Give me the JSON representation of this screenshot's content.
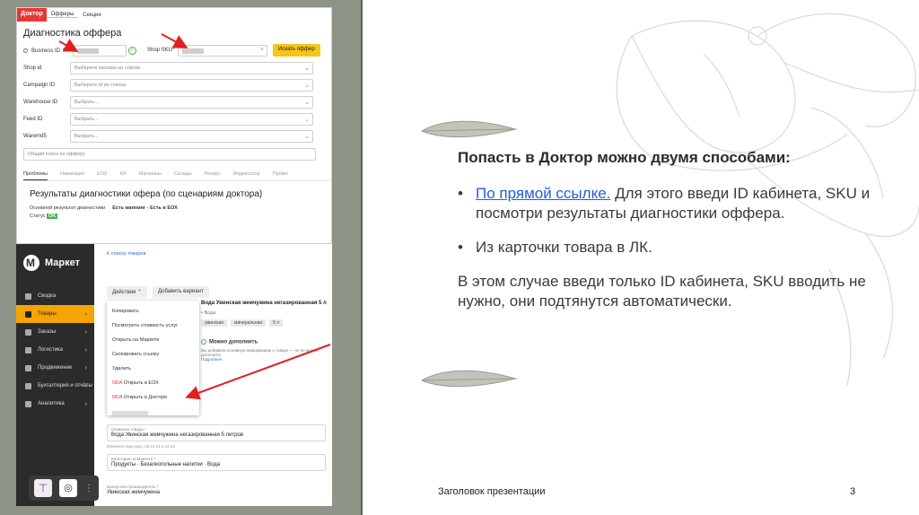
{
  "doctor": {
    "logo": "Доктор",
    "tabs": [
      "Офферы",
      "Секции"
    ],
    "title": "Диагностика оффера",
    "business_id_label": "Business ID ⇕",
    "shop_sku_label": "Shop SKU*",
    "search_button": "Искать оффер",
    "form": [
      {
        "label": "Shop id",
        "placeholder": "Выберите магазин из списка"
      },
      {
        "label": "Campaign ID",
        "placeholder": "Выберите id из списка"
      },
      {
        "label": "Warehouse ID",
        "placeholder": "Выбрать..."
      },
      {
        "label": "Feed ID",
        "placeholder": "Выбрать..."
      },
      {
        "label": "Waremd5",
        "placeholder": "Выбрать..."
      }
    ],
    "general_search_placeholder": "Общий поиск по офферу",
    "result_tabs": [
      "Проблемы",
      "Навигация",
      "ЕОХ",
      "КИ",
      "Магазины",
      "Склады",
      "Репорт",
      "Индексатор",
      "Промо"
    ],
    "results_title": "Результаты диагностики офера (по сценариям доктора)",
    "main_result_label": "Основной результат диагностики",
    "main_result_value": "Есть маппинг - Есть в ЕОХ",
    "status_label": "Статус",
    "status_value": "OK"
  },
  "market": {
    "logo": "Маркет",
    "menu": [
      {
        "label": "Сводка",
        "active": false,
        "arrow": ""
      },
      {
        "label": "Товары",
        "active": true,
        "arrow": "›"
      },
      {
        "label": "Заказы",
        "active": false,
        "arrow": "›"
      },
      {
        "label": "Логистика",
        "active": false,
        "arrow": "›"
      },
      {
        "label": "Продвижение",
        "active": false,
        "arrow": "›"
      },
      {
        "label": "Бухгалтерия и отчёты",
        "active": false,
        "arrow": "›"
      },
      {
        "label": "Аналитика",
        "active": false,
        "arrow": "›"
      }
    ],
    "back_link": "К списку товаров",
    "actions_button": "Действия ⌃",
    "add_variant_button": "Добавить вариант",
    "dropdown": [
      {
        "prefix": "",
        "label": "Копировать"
      },
      {
        "prefix": "",
        "label": "Посмотреть стоимость услуг"
      },
      {
        "prefix": "",
        "label": "Открыть на Маркете"
      },
      {
        "prefix": "",
        "label": "Скопировать ссылку"
      },
      {
        "prefix": "",
        "label": "Удалить"
      },
      {
        "prefix": "NDA",
        "label": " Открыть в ЕОХ"
      },
      {
        "prefix": "NDA",
        "label": " Открыть в Докторе"
      }
    ],
    "product_title": "Вода Увинская жемчужина негазированная 5 л",
    "product_sub": "• Вода",
    "chips": [
      "увинская",
      "минеральная",
      "5 л"
    ],
    "maybe_title": "Можно дополнить",
    "maybe_text": "Вы добавили основную информацию о товаре — но её можно дополнить",
    "maybe_link": "Подробнее",
    "name_label": "Название товара *",
    "name_value": "Вода Увинская жемчужина негазированная 5 литров",
    "changed_text": "Изменено вручную, 09.10.23 в 12:43",
    "category_label": "Категория на Маркете *",
    "category_value": "Продукты · Безалкогольные напитки · Вода",
    "manufacturer_label": "Бренд или производитель *",
    "manufacturer_value": "Увинская жемчужина"
  },
  "slide": {
    "heading": "Попасть в Доктор можно двумя способами:",
    "bullet1_link": "По прямой ссылке.",
    "bullet1_text": " Для этого введи ID кабинета, SKU и посмотри результаты диагностики оффера.",
    "bullet2_text": "Из карточки товара в ЛК.",
    "bullet_marker": "•",
    "note": "В этом случае введи только ID кабинета, SKU вводить не нужно, они подтянутся автоматически.",
    "footer_title": "Заголовок презентации",
    "page_number": "3"
  },
  "colors": {
    "accent_yellow": "#f5c518",
    "doctor_red": "#e53935",
    "link_blue": "#1f5fd6",
    "sidebar_dark": "#2b2b2b",
    "panel_gray": "#8e9488"
  }
}
